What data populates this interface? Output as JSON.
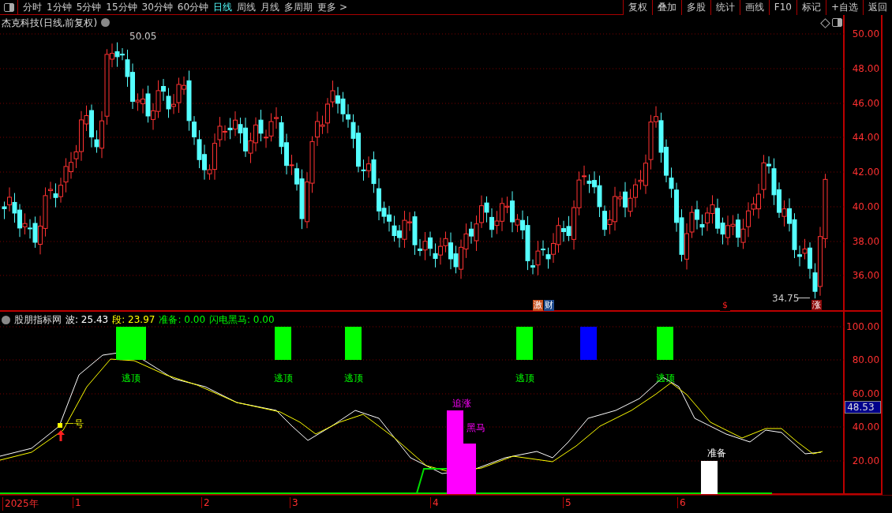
{
  "toolbar": {
    "periods": [
      {
        "label": "分时",
        "selected": false
      },
      {
        "label": "1分钟",
        "selected": false
      },
      {
        "label": "5分钟",
        "selected": false
      },
      {
        "label": "15分钟",
        "selected": false
      },
      {
        "label": "30分钟",
        "selected": false
      },
      {
        "label": "60分钟",
        "selected": false
      },
      {
        "label": "日线",
        "selected": true
      },
      {
        "label": "周线",
        "selected": false
      },
      {
        "label": "月线",
        "selected": false
      },
      {
        "label": "多周期",
        "selected": false
      },
      {
        "label": "更多 >",
        "selected": false
      }
    ],
    "buttons": [
      "复权",
      "叠加",
      "多股",
      "统计",
      "画线",
      "F10",
      "标记",
      "+自选",
      "返回"
    ]
  },
  "price_chart": {
    "title": "杰克科技(日线,前复权)",
    "high_label": "50.05",
    "low_label": "34.75",
    "axis_labels": [
      "50.00",
      "48.00",
      "46.00",
      "44.00",
      "42.00",
      "40.00",
      "38.00",
      "36.00"
    ],
    "badges": [
      {
        "text": "激",
        "color": "#c8501e"
      },
      {
        "text": "财",
        "color": "#1e4a8c"
      },
      {
        "text": "$",
        "color": "#000000"
      },
      {
        "text": "涨",
        "color": "#8c0a0a"
      }
    ]
  },
  "indicator": {
    "name": "股朋指标网",
    "readings": [
      {
        "label": "波: 25.43",
        "color": "#ffffff"
      },
      {
        "label": "段: 23.97",
        "color": "#ffff00"
      },
      {
        "label": "准备: 0.00",
        "color": "#00ff00"
      },
      {
        "label": "闪电黑马: 0.00",
        "color": "#00ff00"
      }
    ],
    "axis_labels": [
      "100.00",
      "80.00",
      "60.00",
      "40.00",
      "20.00"
    ],
    "current_value": "48.53",
    "top_signals": [
      {
        "label": "逃顶",
        "color": "#00ff00"
      },
      {
        "label": "逃顶",
        "color": "#00ff00"
      },
      {
        "label": "逃顶",
        "color": "#00ff00"
      },
      {
        "label": "逃顶",
        "color": "#00ff00"
      },
      {
        "color": "#0000ff"
      },
      {
        "label": "逃顶",
        "color": "#00ff00"
      }
    ],
    "chase_signal": {
      "labels": [
        "追涨",
        "黑马"
      ]
    },
    "ready_signal": {
      "label": "准备"
    },
    "yellow_label": "一号"
  },
  "time_axis": [
    "2025年",
    "1",
    "2",
    "3",
    "4",
    "5",
    "6"
  ]
}
